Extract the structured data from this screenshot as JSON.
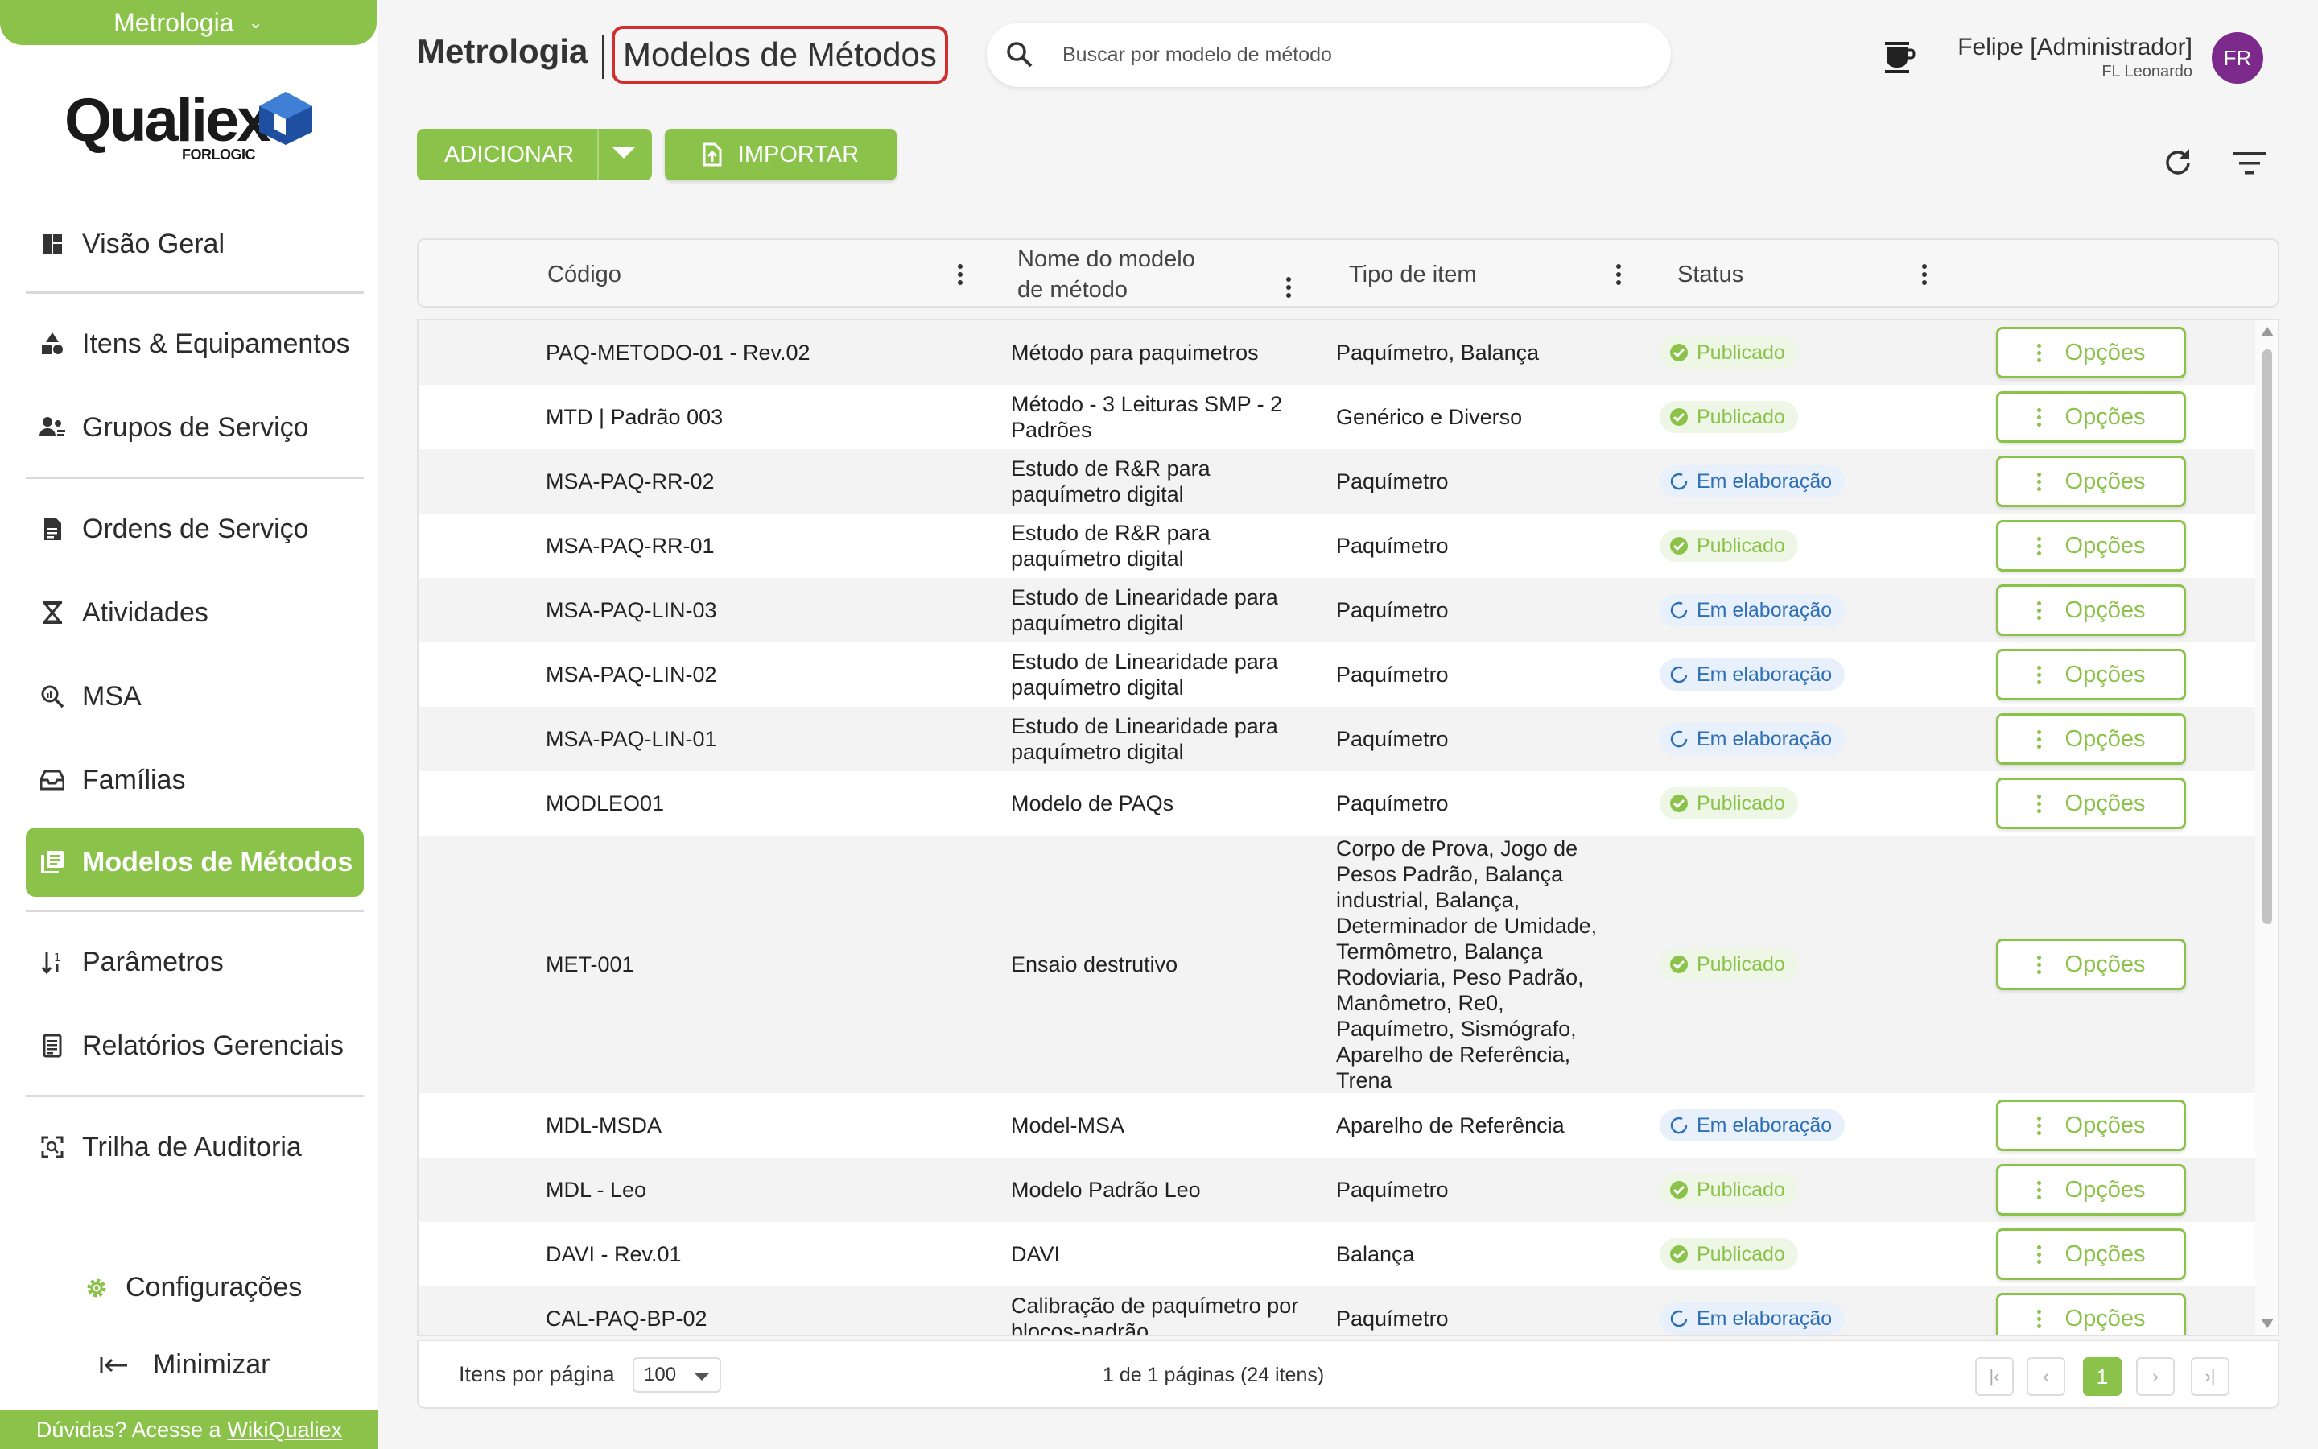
{
  "app": {
    "module_selector": "Metrologia",
    "logo_text": "Qualiex",
    "logo_sub": "FORLOGIC"
  },
  "sidebar": {
    "items": [
      {
        "label": "Visão Geral",
        "icon": "dashboard-icon"
      },
      {
        "label": "Itens & Equipamentos",
        "icon": "shapes-icon"
      },
      {
        "label": "Grupos de Serviço",
        "icon": "people-group-icon"
      },
      {
        "label": "Ordens de Serviço",
        "icon": "document-icon"
      },
      {
        "label": "Atividades",
        "icon": "hourglass-icon"
      },
      {
        "label": "MSA",
        "icon": "magnify-chart-icon"
      },
      {
        "label": "Famílias",
        "icon": "inbox-tray-icon"
      },
      {
        "label": "Modelos de Métodos",
        "icon": "library-icon",
        "active": true
      },
      {
        "label": "Parâmetros",
        "icon": "sort-numeric-icon"
      },
      {
        "label": "Relatórios Gerenciais",
        "icon": "report-icon"
      },
      {
        "label": "Trilha de Auditoria",
        "icon": "audit-scan-icon"
      }
    ],
    "config_label": "Configurações",
    "minimize_label": "Minimizar",
    "help_text": "Dúvidas? Acesse a",
    "help_link": "WikiQualiex"
  },
  "header": {
    "module": "Metrologia",
    "page": "Modelos de Métodos",
    "search_placeholder": "Buscar por modelo de método",
    "user_name": "Felipe [Administrador]",
    "user_org": "FL Leonardo",
    "avatar_initials": "FR"
  },
  "toolbar": {
    "add_label": "ADICIONAR",
    "import_label": "IMPORTAR"
  },
  "table": {
    "columns": [
      "Código",
      "Nome do modelo de método",
      "Tipo de item",
      "Status"
    ],
    "options_label": "Opções",
    "rows": [
      {
        "code": "PAQ-METODO-01 - Rev.02",
        "name": "Método para paquimetros",
        "type": "Paquímetro, Balança",
        "status": "Publicado"
      },
      {
        "code": "MTD | Padrão 003",
        "name": "Método - 3 Leituras SMP - 2 Padrões",
        "type": "Genérico e Diverso",
        "status": "Publicado"
      },
      {
        "code": "MSA-PAQ-RR-02",
        "name": "Estudo de R&R para paquímetro digital",
        "type": "Paquímetro",
        "status": "Em elaboração"
      },
      {
        "code": "MSA-PAQ-RR-01",
        "name": "Estudo de R&R para paquímetro digital",
        "type": "Paquímetro",
        "status": "Publicado"
      },
      {
        "code": "MSA-PAQ-LIN-03",
        "name": "Estudo de Linearidade para paquímetro digital",
        "type": "Paquímetro",
        "status": "Em elaboração"
      },
      {
        "code": "MSA-PAQ-LIN-02",
        "name": "Estudo de Linearidade para paquímetro digital",
        "type": "Paquímetro",
        "status": "Em elaboração"
      },
      {
        "code": "MSA-PAQ-LIN-01",
        "name": "Estudo de Linearidade para paquímetro digital",
        "type": "Paquímetro",
        "status": "Em elaboração"
      },
      {
        "code": "MODLEO01",
        "name": "Modelo de PAQs",
        "type": "Paquímetro",
        "status": "Publicado"
      },
      {
        "code": "MET-001",
        "name": "Ensaio destrutivo",
        "type": "Corpo de Prova, Jogo de Pesos Padrão, Balança industrial, Balança, Determinador de Umidade, Termômetro, Balança Rodoviaria, Peso Padrão, Manômetro, Re0, Paquímetro, Sismógrafo, Aparelho de Referência, Trena",
        "status": "Publicado"
      },
      {
        "code": "MDL-MSDA",
        "name": "Model-MSA",
        "type": "Aparelho de Referência",
        "status": "Em elaboração"
      },
      {
        "code": "MDL - Leo",
        "name": "Modelo Padrão Leo",
        "type": "Paquímetro",
        "status": "Publicado"
      },
      {
        "code": "DAVI - Rev.01",
        "name": "DAVI",
        "type": "Balança",
        "status": "Publicado"
      },
      {
        "code": "CAL-PAQ-BP-02",
        "name": "Calibração de paquímetro por blocos-padrão",
        "type": "Paquímetro",
        "status": "Em elaboração"
      }
    ]
  },
  "pagination": {
    "items_per_page_label": "Itens por página",
    "items_per_page": "100",
    "info": "1 de 1 páginas (24 itens)",
    "current_page": "1"
  },
  "colors": {
    "accent": "#8bc34a",
    "highlight_border": "#d32f2f",
    "elab_text": "#2f6fb5",
    "avatar": "#7b2a8c"
  }
}
